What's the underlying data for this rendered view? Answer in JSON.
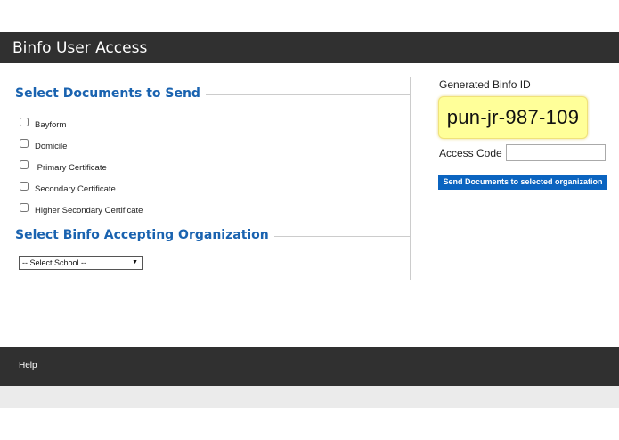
{
  "header": {
    "title": "Binfo User Access"
  },
  "documents": {
    "heading": "Select Documents to Send",
    "items": [
      {
        "label": "Bayform",
        "checked": false
      },
      {
        "label": "Domicile",
        "checked": false
      },
      {
        "label": " Primary Certificate",
        "checked": false
      },
      {
        "label": "Secondary Certificate",
        "checked": false
      },
      {
        "label": "Higher Secondary Certificate",
        "checked": false
      }
    ]
  },
  "organization": {
    "heading": "Select Binfo Accepting Organization",
    "select_value": "-- Select School --"
  },
  "binfo": {
    "label": "Generated Binfo ID",
    "id": "pun-jr-987-109",
    "access_code_label": "Access Code :",
    "access_code_value": "",
    "send_button_label": "Send Documents to selected organization"
  },
  "footer": {
    "help_label": "Help"
  },
  "colors": {
    "header_bg": "#303030",
    "heading_blue": "#1a63b0",
    "button_blue": "#0b64c0",
    "id_highlight": "#ffff99"
  }
}
